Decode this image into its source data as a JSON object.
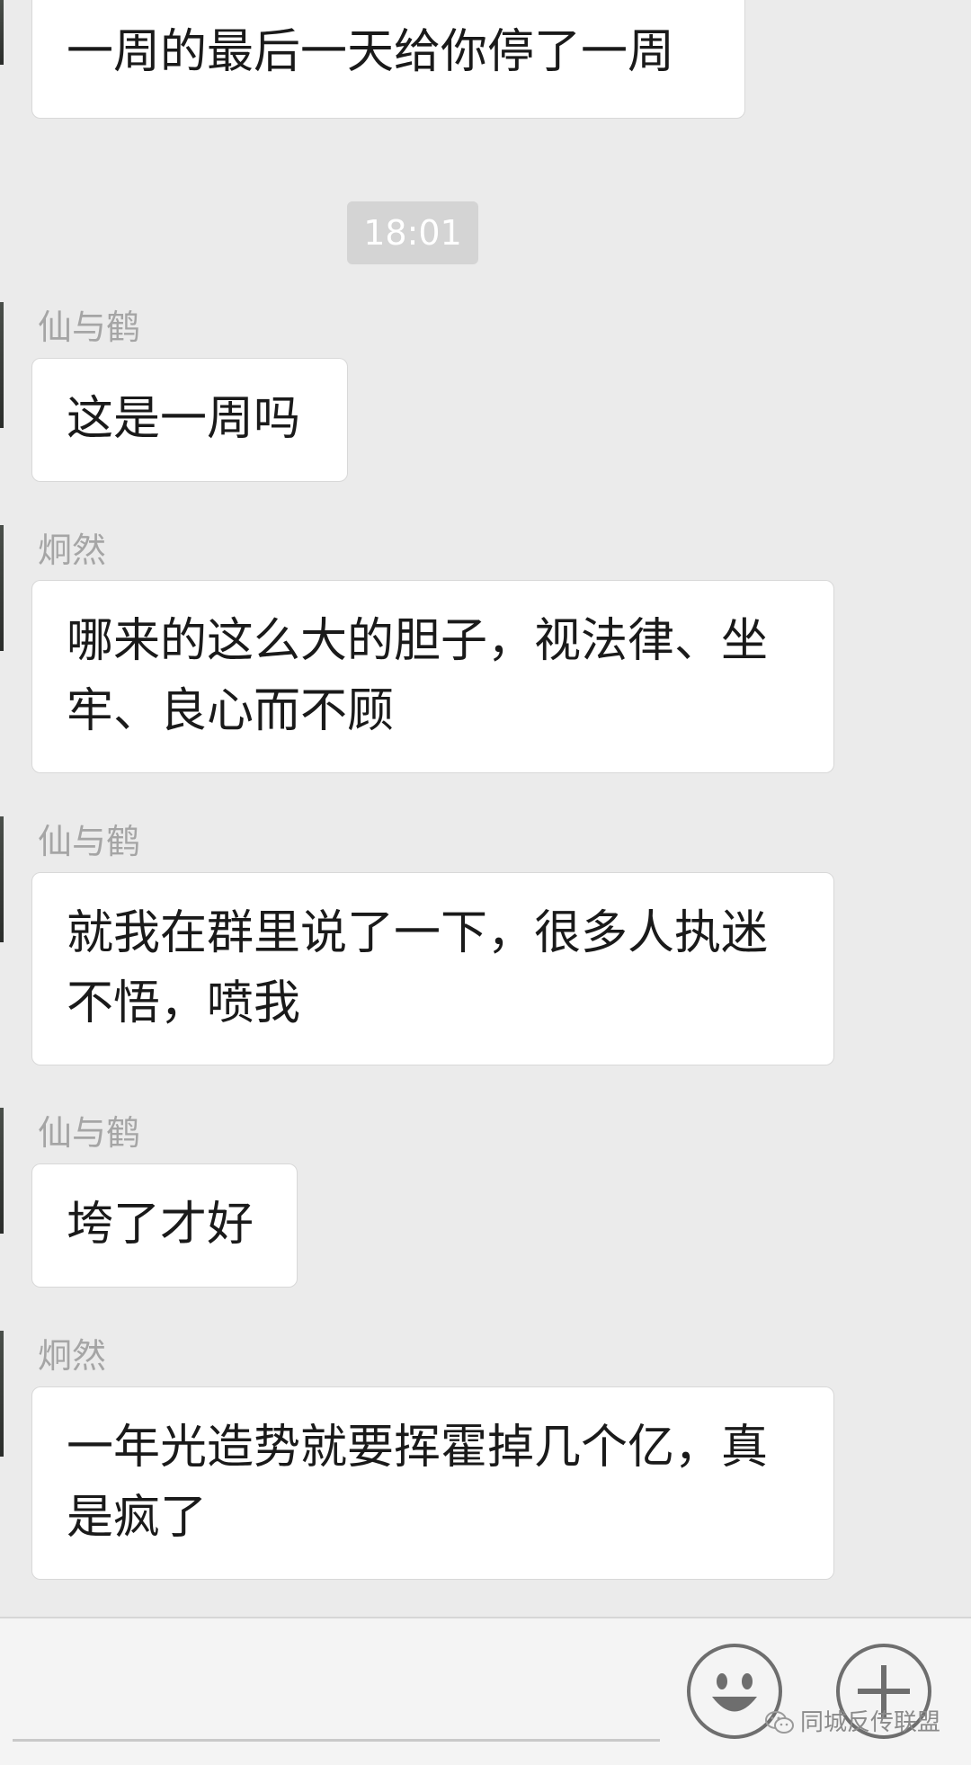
{
  "messages": [
    {
      "sender": "",
      "text": "一周的最后一天给你停了一周"
    },
    {
      "sender": "仙与鹤",
      "text": "这是一周吗"
    },
    {
      "sender": "炯然",
      "text": "哪来的这么大的胆子，视法律、坐牢、良心而不顾"
    },
    {
      "sender": "仙与鹤",
      "text": "就我在群里说了一下，很多人执迷不悟，喷我"
    },
    {
      "sender": "仙与鹤",
      "text": "垮了才好"
    },
    {
      "sender": "炯然",
      "text": "一年光造势就要挥霍掉几个亿，真是疯了"
    }
  ],
  "timestamp": "18:01",
  "input": {
    "emoji_icon": "smiley-face-icon",
    "plus_icon": "plus-icon"
  },
  "watermark": {
    "text": "同城反传联盟",
    "icon": "wechat-icon"
  }
}
